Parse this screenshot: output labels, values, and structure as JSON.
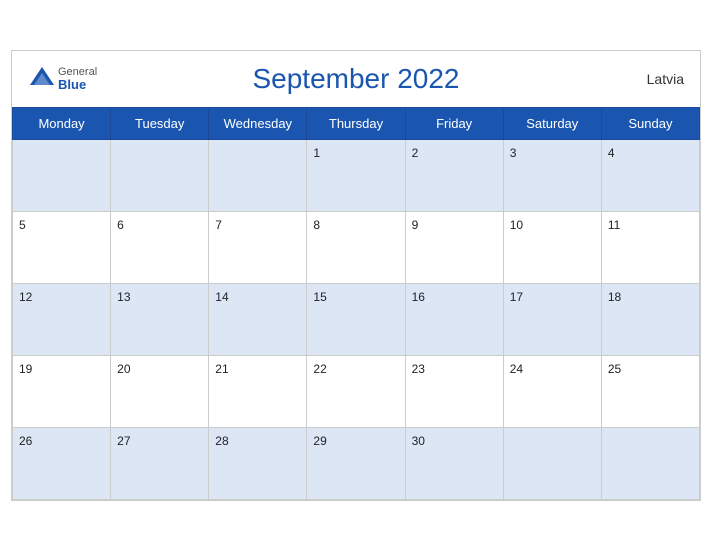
{
  "header": {
    "title": "September 2022",
    "country": "Latvia",
    "logo": {
      "general": "General",
      "blue": "Blue"
    }
  },
  "weekdays": [
    "Monday",
    "Tuesday",
    "Wednesday",
    "Thursday",
    "Friday",
    "Saturday",
    "Sunday"
  ],
  "weeks": [
    [
      null,
      null,
      null,
      1,
      2,
      3,
      4
    ],
    [
      5,
      6,
      7,
      8,
      9,
      10,
      11
    ],
    [
      12,
      13,
      14,
      15,
      16,
      17,
      18
    ],
    [
      19,
      20,
      21,
      22,
      23,
      24,
      25
    ],
    [
      26,
      27,
      28,
      29,
      30,
      null,
      null
    ]
  ]
}
